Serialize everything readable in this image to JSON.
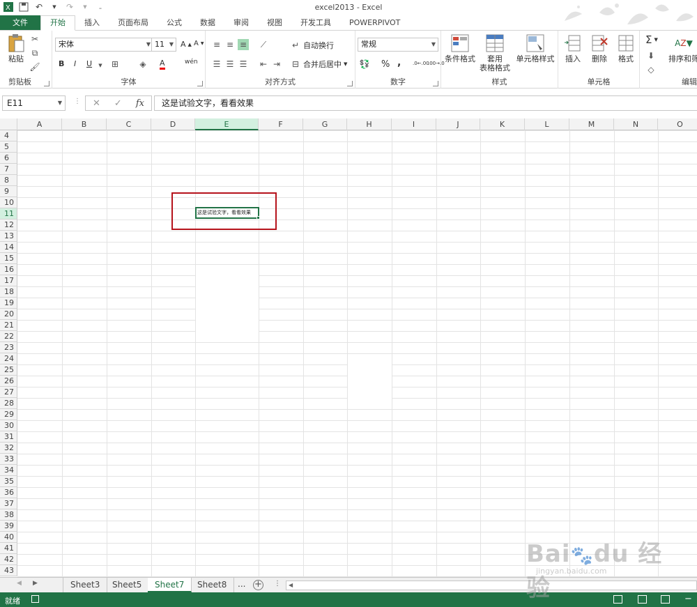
{
  "window": {
    "title": "excel2013 - Excel",
    "qat_icons": [
      "excel-logo-icon",
      "save-icon",
      "undo-icon",
      "redo-icon",
      "customize-icon"
    ]
  },
  "tabs": [
    "文件",
    "开始",
    "插入",
    "页面布局",
    "公式",
    "数据",
    "审阅",
    "视图",
    "开发工具",
    "POWERPIVOT"
  ],
  "ribbon": {
    "clipboard": {
      "paste": "粘贴",
      "label": "剪贴板"
    },
    "font": {
      "name": "宋体",
      "size": "11",
      "label": "字体",
      "bold": "B",
      "italic": "I",
      "underline": "U",
      "phonetic": "wén"
    },
    "alignment": {
      "wrap": "自动换行",
      "merge": "合并后居中",
      "label": "对齐方式"
    },
    "number": {
      "format": "常规",
      "label": "数字",
      "percent": "%",
      "comma": ",",
      "inc_decimal": ".00→.0",
      "dec_decimal": ".0→.00"
    },
    "styles": {
      "conditional": "条件格式",
      "table_line1": "套用",
      "table_line2": "表格格式",
      "cell_styles": "单元格样式",
      "label": "样式"
    },
    "cells": {
      "insert": "插入",
      "delete": "删除",
      "format": "格式",
      "label": "单元格"
    },
    "editing": {
      "sort": "排序和筛",
      "label": "编辑"
    }
  },
  "formula_bar": {
    "name_box": "E11",
    "cancel": "✕",
    "enter": "✓",
    "fx": "fx",
    "content": "这是试验文字，看看效果"
  },
  "grid": {
    "columns": [
      "A",
      "B",
      "C",
      "D",
      "E",
      "F",
      "G",
      "H",
      "I",
      "J",
      "K",
      "L",
      "M",
      "N",
      "O"
    ],
    "selected_column": "E",
    "rows": [
      "4",
      "5",
      "6",
      "7",
      "8",
      "9",
      "10",
      "11",
      "12",
      "13",
      "14",
      "15",
      "16",
      "17",
      "18",
      "19",
      "20",
      "21",
      "22",
      "23",
      "24",
      "25",
      "26",
      "27",
      "28",
      "29",
      "30",
      "31",
      "32",
      "33",
      "34",
      "35",
      "36",
      "37",
      "38",
      "39",
      "40",
      "41",
      "42",
      "43"
    ],
    "selected_row": "11",
    "active_cell_text": "这是试验文字，看看效果"
  },
  "sheets": {
    "tabs": [
      "Sheet3",
      "Sheet5",
      "Sheet7",
      "Sheet8"
    ],
    "active": "Sheet7",
    "more": "...",
    "add": "+"
  },
  "status": {
    "text": "就绪"
  },
  "watermark": {
    "logo": "Bai du 经验",
    "url": "jingyan.baidu.com"
  },
  "colors": {
    "excel_green": "#217346",
    "highlight_red": "#b5121b"
  }
}
